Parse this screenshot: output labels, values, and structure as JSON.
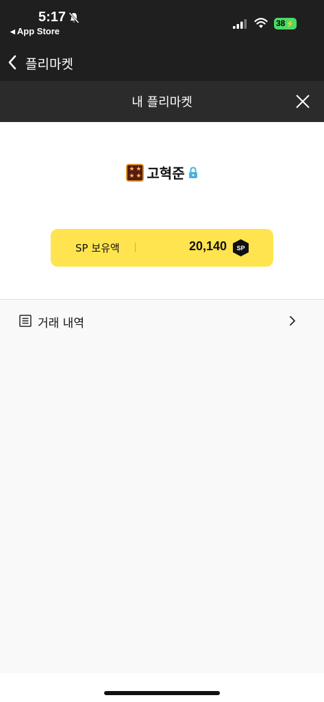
{
  "status_bar": {
    "time": "5:17",
    "back_app": "App Store",
    "back_glyph": "◀",
    "battery": "38",
    "icons": [
      "bell-slash-icon",
      "signal-icon",
      "wifi-icon",
      "battery-icon"
    ]
  },
  "nav": {
    "title": "플리마켓",
    "back_icon": "chevron-left-icon"
  },
  "modal": {
    "title": "내 플리마켓",
    "close_icon": "close-icon"
  },
  "profile": {
    "username": "고혁준",
    "grade_icon": "grade-badge-icon",
    "grade_stars": [
      "★",
      "★",
      "★",
      "★"
    ],
    "lock_icon": "lock-icon"
  },
  "sp": {
    "label": "SP 보유액",
    "value": "20,140",
    "badge": "SP",
    "colors": {
      "box": "#ffe44f",
      "badge": "#111111"
    }
  },
  "menu": {
    "history_label": "거래 내역",
    "history_icon": "document-list-icon",
    "chevron_icon": "chevron-right-icon"
  },
  "colors": {
    "header_dark": "#1f1f1f",
    "modal_header": "#2b2b2b",
    "lock_blue": "#4bb3d8",
    "battery_green": "#4cd964"
  }
}
